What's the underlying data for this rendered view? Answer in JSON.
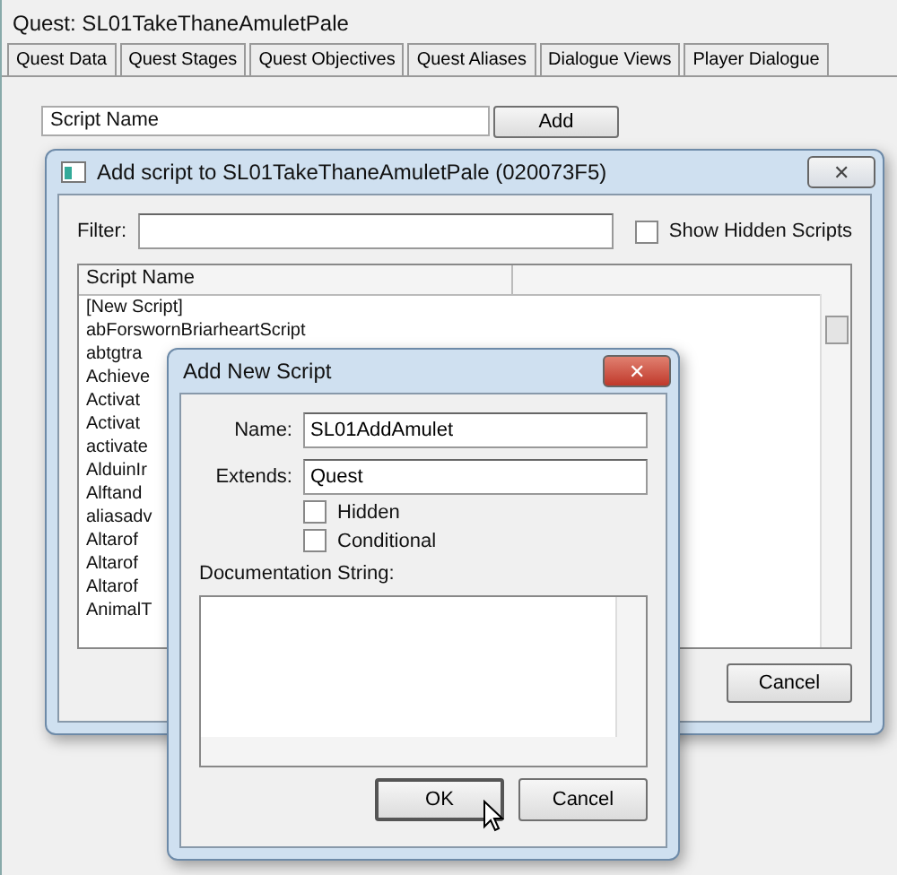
{
  "window": {
    "title": "Quest: SL01TakeThaneAmuletPale"
  },
  "tabs": [
    {
      "label": "Quest Data",
      "selected": false
    },
    {
      "label": "Quest Stages",
      "selected": false
    },
    {
      "label": "Quest Objectives",
      "selected": false
    },
    {
      "label": "Quest Aliases",
      "selected": false
    },
    {
      "label": "Dialogue Views",
      "selected": false
    },
    {
      "label": "Player Dialogue",
      "selected": false
    }
  ],
  "scripts_panel": {
    "column": "Script Name",
    "add_button": "Add"
  },
  "add_script_dialog": {
    "title": "Add script to SL01TakeThaneAmuletPale (020073F5)",
    "close": "✕",
    "filter_label": "Filter:",
    "show_hidden": {
      "label": "Show Hidden Scripts",
      "checked": false
    },
    "column": "Script Name",
    "items": [
      {
        "name": "[New Script]",
        "selected": false
      },
      {
        "name": "abForswornBriarheartScript",
        "selected": false
      },
      {
        "name": "abtgtra",
        "selected": false
      },
      {
        "name": "Achieve",
        "selected": false
      },
      {
        "name": "Activat",
        "selected": false
      },
      {
        "name": "Activat",
        "selected": false
      },
      {
        "name": "activate",
        "selected": false
      },
      {
        "name": "AlduinIr",
        "selected": false
      },
      {
        "name": "Alftand",
        "selected": false
      },
      {
        "name": "aliasadv",
        "selected": false
      },
      {
        "name": "Altarof",
        "selected": false
      },
      {
        "name": "Altarof",
        "selected": false
      },
      {
        "name": "Altarof",
        "selected": false
      },
      {
        "name": "AnimalT",
        "selected": false
      }
    ],
    "cancel_button": "Cancel"
  },
  "new_script_dialog": {
    "title": "Add New Script",
    "close": "✕",
    "name_label": "Name:",
    "name_value": "SL01AddAmulet",
    "extends_label": "Extends:",
    "extends_value": "Quest",
    "options": [
      {
        "label": "Hidden",
        "checked": false
      },
      {
        "label": "Conditional",
        "checked": false
      }
    ],
    "doc_label": "Documentation String:",
    "ok_button": "OK",
    "cancel_button": "Cancel"
  }
}
